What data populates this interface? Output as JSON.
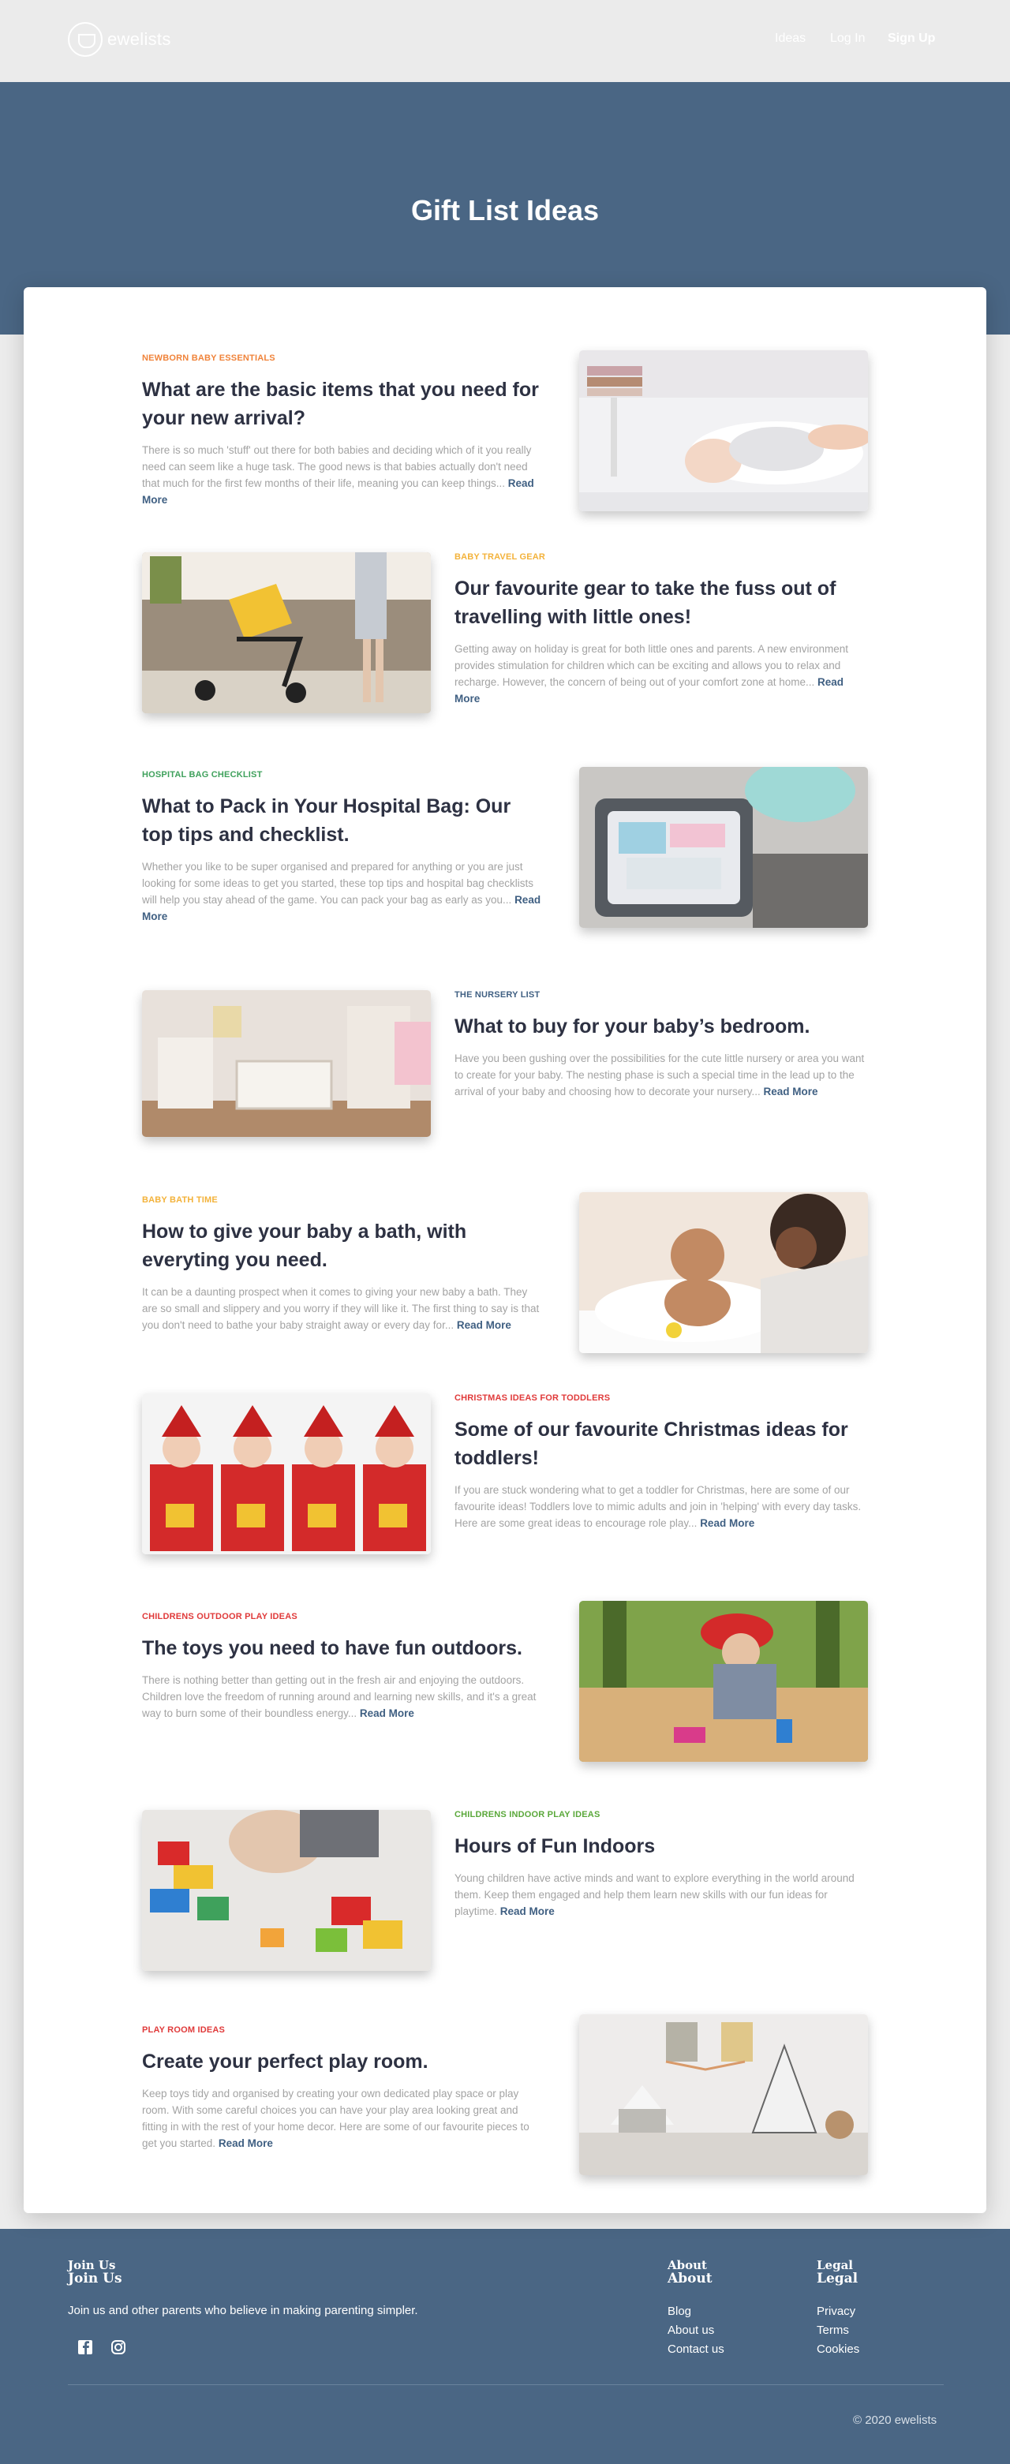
{
  "brand": {
    "name": "ewelists"
  },
  "nav": {
    "ideas": "Ideas",
    "login": "Log In",
    "signup": "Sign Up"
  },
  "hero": {
    "title": "Gift List Ideas"
  },
  "read_more_label": "Read More",
  "articles": [
    {
      "category": "Newborn Baby Essentials",
      "category_color": "#f0833a",
      "title": "What are the basic items that you need for your new arrival?",
      "description": "There is so much 'stuff' out there for both babies and deciding which of it you really need can seem like a huge task. The good news is that babies actually don't need that much for the first few months of their life, meaning you can keep things...",
      "image_icon": "newborn-baby-photo"
    },
    {
      "category": "Baby Travel Gear",
      "category_color": "#f3b23a",
      "title": "Our favourite gear to take the fuss out of travelling with little ones!",
      "description": "Getting away on holiday is great for both little ones and parents. A new environment provides stimulation for children which can be exciting and allows you to relax and recharge. However, the concern of being out of your comfort zone at home...",
      "image_icon": "stroller-photo"
    },
    {
      "category": "Hospital Bag Checklist",
      "category_color": "#3fa15c",
      "title": "What to Pack in Your Hospital Bag: Our top tips and checklist.",
      "description": "Whether you like to be super organised and prepared for anything or you are just looking for some ideas to get you started, these top tips and hospital bag checklists will help you stay ahead of the game. You can pack your bag as early as you...",
      "image_icon": "hospital-bag-photo"
    },
    {
      "category": "The Nursery List",
      "category_color": "#3f5f82",
      "title": "What to buy for your baby’s bedroom.",
      "description": "Have you been gushing over the possibilities for the cute little nursery or area you want to create for your baby. The nesting phase is such a special time in the lead up to the arrival of your baby and choosing how to decorate your nursery...",
      "image_icon": "nursery-photo"
    },
    {
      "category": "Baby Bath Time",
      "category_color": "#f3b23a",
      "title": "How to give your baby a bath, with everyting you need.",
      "description": "It can be a daunting prospect when it comes to giving your new baby a bath. They are so small and slippery and you worry if they will like it. The first thing to say is that you don't need to bathe your baby straight away or every day for...",
      "image_icon": "baby-bath-photo"
    },
    {
      "category": "Christmas Ideas For Toddlers",
      "category_color": "#e03a3a",
      "title": "Some of our favourite Christmas ideas for toddlers!",
      "description": "If you are stuck wondering what to get a toddler for Christmas, here are some of our favourite ideas! Toddlers love to mimic adults and join in 'helping' with every day tasks. Here are some great ideas to encourage role play...",
      "image_icon": "christmas-kids-photo"
    },
    {
      "category": "Childrens Outdoor Play Ideas",
      "category_color": "#e03a3a",
      "title": "The toys you need to have fun outdoors.",
      "description": "There is nothing better than getting out in the fresh air and enjoying the outdoors. Children love the freedom of running around and learning new skills, and it's a great way to burn some of their boundless energy...",
      "image_icon": "outdoor-play-photo"
    },
    {
      "category": "Childrens Indoor Play Ideas",
      "category_color": "#5aa83a",
      "title": "Hours of Fun Indoors",
      "description": "Young children have active minds and want to explore everything in the world around them. Keep them engaged and help them learn new skills with our fun ideas for playtime.",
      "image_icon": "building-blocks-photo"
    },
    {
      "category": "Play Room Ideas",
      "category_color": "#e03a3a",
      "title": "Create your perfect play room.",
      "description": "Keep toys tidy and organised by creating your own dedicated play space or play room. With some careful choices you can have your play area looking great and fitting in with the rest of your home decor. Here are some of our favourite pieces to get you started.",
      "image_icon": "playroom-photo"
    }
  ],
  "footer": {
    "join": {
      "heading": "Join Us",
      "text": "Join us and other parents who believe in making parenting simpler."
    },
    "about": {
      "heading": "About",
      "links": [
        "Blog",
        "About us",
        "Contact us"
      ]
    },
    "legal": {
      "heading": "Legal",
      "links": [
        "Privacy",
        "Terms",
        "Cookies"
      ]
    },
    "social": [
      "facebook-icon",
      "instagram-icon"
    ],
    "copyright": "© 2020 ewelists"
  }
}
